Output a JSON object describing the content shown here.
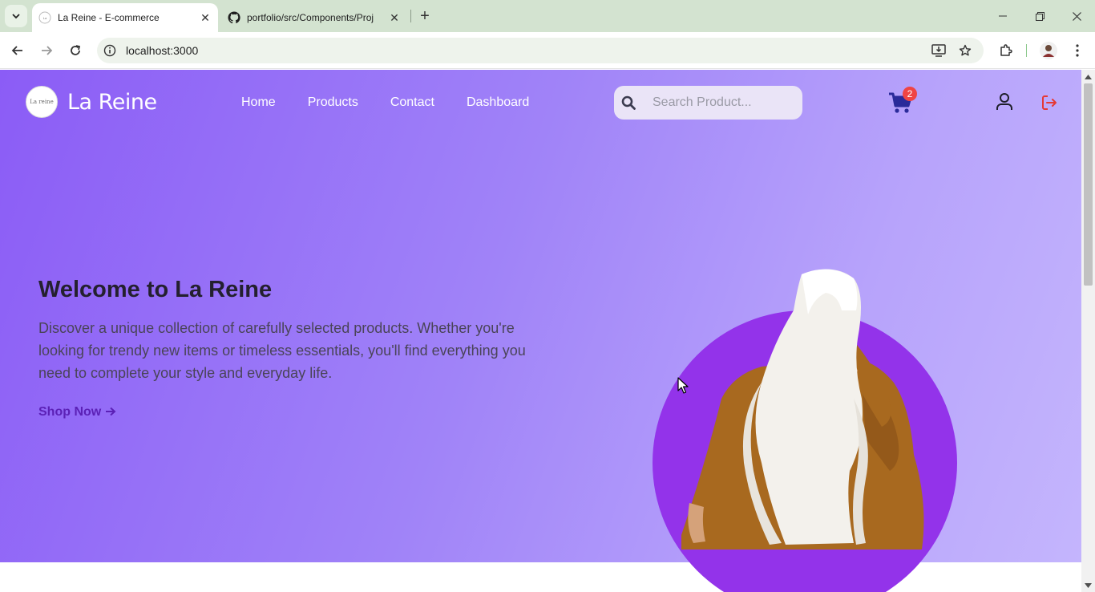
{
  "browser": {
    "tabs": [
      {
        "title": "La Reine - E-commerce",
        "active": true
      },
      {
        "title": "portfolio/src/Components/Proj",
        "active": false
      }
    ],
    "url": "localhost:3000"
  },
  "header": {
    "brand": "La Reine",
    "logo_text": "La reine",
    "nav": [
      "Home",
      "Products",
      "Contact",
      "Dashboard"
    ],
    "search_placeholder": "Search Product...",
    "cart_count": "2"
  },
  "hero": {
    "title": "Welcome to La Reine",
    "description": "Discover a unique collection of carefully selected products. Whether you're looking for trendy new items or timeless essentials, you'll find everything you need to complete your style and everyday life.",
    "cta": "Shop Now"
  },
  "colors": {
    "hero_gradient_start": "#8b5cf6",
    "hero_gradient_end": "#c4b5fd",
    "accent_circle": "#9333ea",
    "cart_icon": "#2a2a9a",
    "badge": "#ef4444",
    "logout_icon": "#e53935"
  },
  "icons": [
    "tab-search-icon",
    "back-icon",
    "forward-icon",
    "reload-icon",
    "site-info-icon",
    "install-app-icon",
    "bookmark-star-icon",
    "extensions-icon",
    "profile-avatar",
    "chrome-menu-icon",
    "search-icon",
    "cart-icon",
    "user-icon",
    "logout-icon"
  ]
}
